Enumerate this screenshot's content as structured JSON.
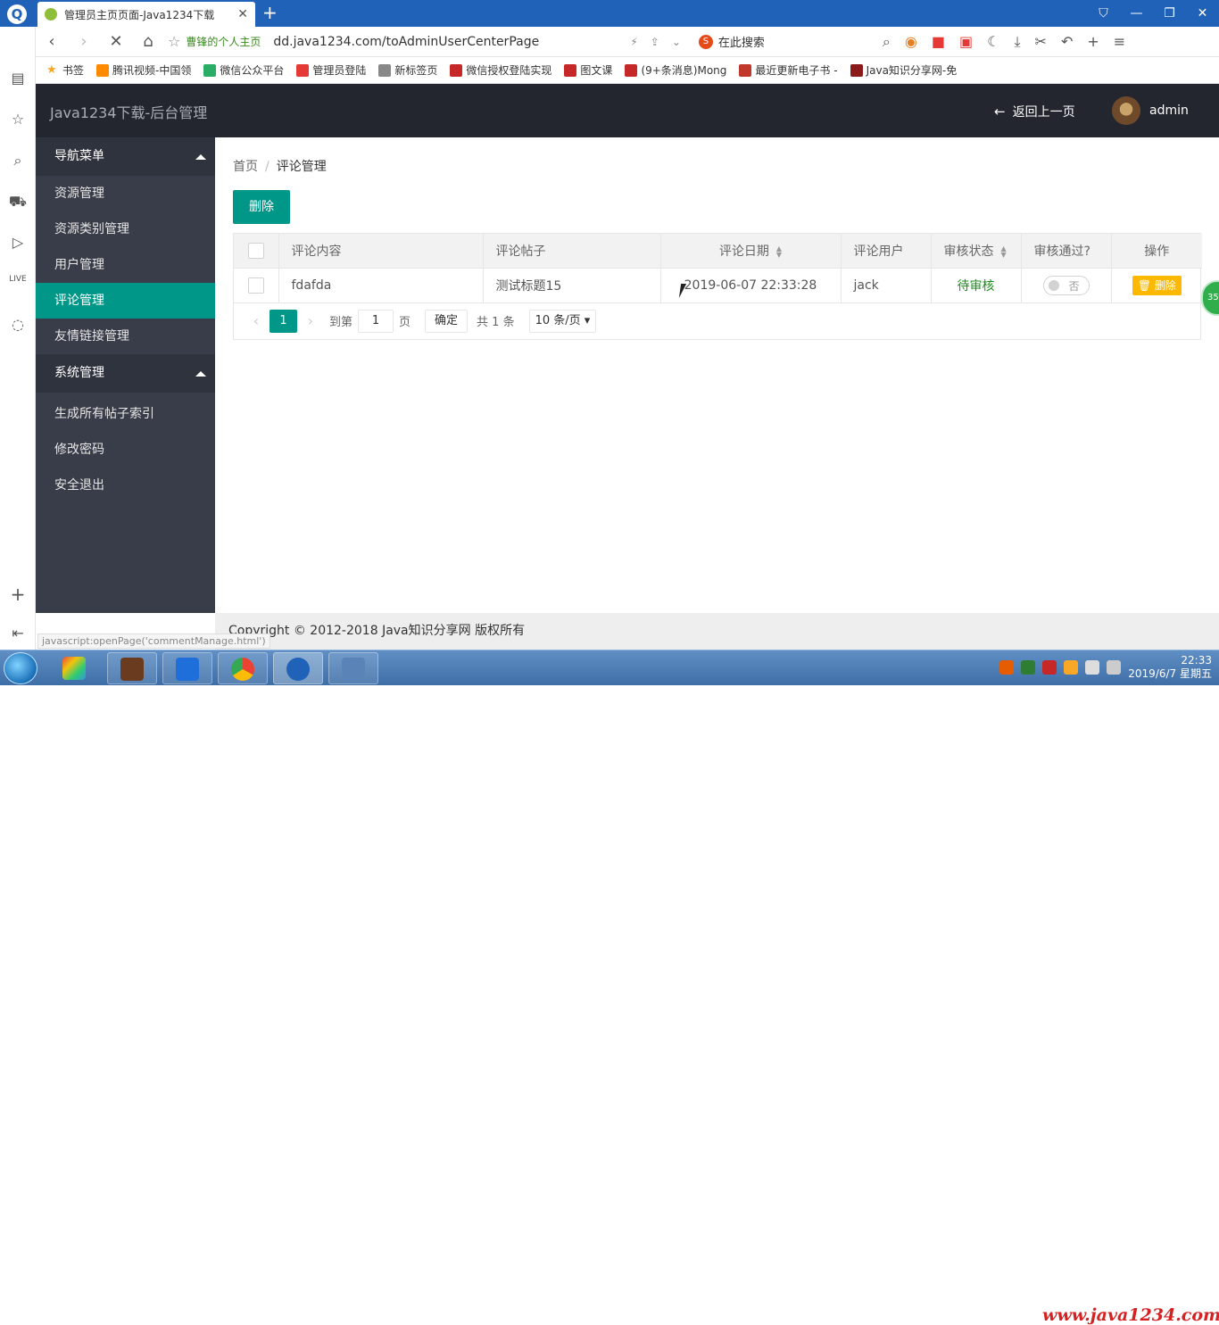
{
  "browser": {
    "tab_title": "管理员主页页面-Java1234下载",
    "home_label": "曹锋的个人主页",
    "url": "dd.java1234.com/toAdminUserCenterPage",
    "search_placeholder": "在此搜索",
    "bookmarks": [
      {
        "label": "书签",
        "color": "#f5a623"
      },
      {
        "label": "腾讯视频-中国领",
        "color": "#ff8a00"
      },
      {
        "label": "微信公众平台",
        "color": "#2aae67"
      },
      {
        "label": "管理员登陆",
        "color": "#e53935"
      },
      {
        "label": "新标签页",
        "color": "#888888"
      },
      {
        "label": "微信授权登陆实现",
        "color": "#c62828"
      },
      {
        "label": "图文课",
        "color": "#c62828"
      },
      {
        "label": "(9+条消息)Mong",
        "color": "#c62828"
      },
      {
        "label": "最近更新电子书 -",
        "color": "#c0392b"
      },
      {
        "label": "Java知识分享网-免",
        "color": "#8b1a1a"
      }
    ],
    "status_url": "javascript:openPage('commentManage.html')"
  },
  "header": {
    "brand": "Java1234下载-后台管理",
    "back_label": "返回上一页",
    "username": "admin"
  },
  "sidebar": {
    "nav_title": "导航菜单",
    "nav_items": [
      "资源管理",
      "资源类别管理",
      "用户管理",
      "评论管理",
      "友情链接管理"
    ],
    "active_index": 3,
    "sys_title": "系统管理",
    "sys_items": [
      "生成所有帖子索引",
      "修改密码",
      "安全退出"
    ]
  },
  "breadcrumb": {
    "home": "首页",
    "sep": "/",
    "current": "评论管理"
  },
  "toolbar": {
    "delete_label": "删除"
  },
  "table": {
    "headers": [
      "评论内容",
      "评论帖子",
      "评论日期",
      "评论用户",
      "审核状态",
      "审核通过?",
      "操作"
    ],
    "rows": [
      {
        "content": "fdafda",
        "post": "测试标题15",
        "date": "2019-06-07 22:33:28",
        "user": "jack",
        "status": "待审核",
        "approved_label": "否",
        "action": "删除"
      }
    ]
  },
  "pager": {
    "current_page": "1",
    "goto_label": "到第",
    "goto_value": "1",
    "page_unit": "页",
    "confirm": "确定",
    "total": "共 1 条",
    "page_size": "10 条/页"
  },
  "footer": {
    "copyright": "Copyright © 2012-2018 Java知识分享网 版权所有"
  },
  "float_badge": "35",
  "taskbar": {
    "clock_time": "22:33",
    "clock_date": "2019/6/7 星期五",
    "watermark": "www.java1234.com"
  }
}
